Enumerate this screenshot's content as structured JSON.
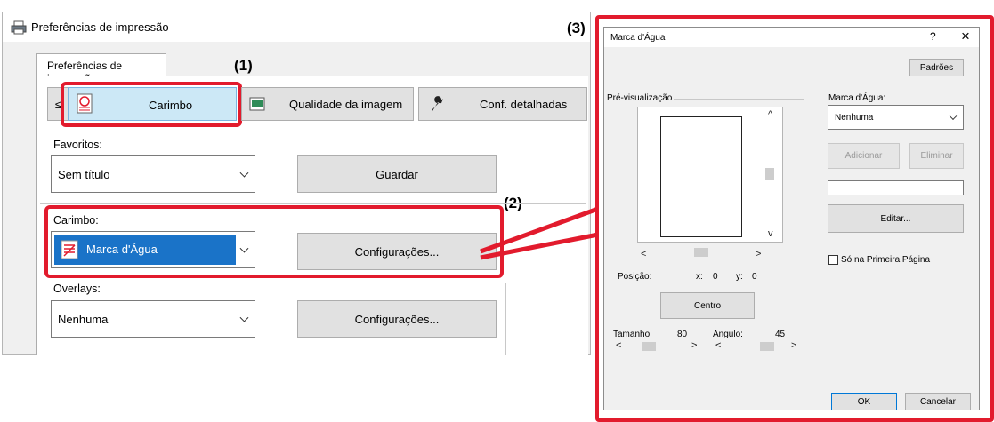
{
  "left_window": {
    "title": "Preferências de impressão",
    "tab": "Preferências de impressão",
    "nav_back": "≤",
    "tabs": [
      {
        "label": "Carimbo"
      },
      {
        "label": "Qualidade da imagem"
      },
      {
        "label": "Conf. detalhadas"
      }
    ],
    "favoritos": {
      "label": "Favoritos:",
      "value": "Sem título",
      "save": "Guardar"
    },
    "carimbo": {
      "label": "Carimbo:",
      "value": "Marca d'Água",
      "settings": "Configurações..."
    },
    "overlays": {
      "label": "Overlays:",
      "value": "Nenhuma",
      "settings": "Configurações..."
    }
  },
  "callouts": {
    "c1": "(1)",
    "c2": "(2)",
    "c3": "(3)"
  },
  "watermark_dialog": {
    "title": "Marca d'Água",
    "help": "?",
    "close": "×",
    "defaults": "Padrões",
    "preview_label": "Pré-visualização",
    "position_label": "Posição:",
    "x_label": "x:",
    "x_value": "0",
    "y_label": "y:",
    "y_value": "0",
    "center": "Centro",
    "size_label": "Tamanho:",
    "size_value": "80",
    "angle_label": "Angulo:",
    "angle_value": "45",
    "watermark_label": "Marca d'Água:",
    "watermark_value": "Nenhuma",
    "add": "Adicionar",
    "delete": "Eliminar",
    "text_value": "",
    "edit": "Editar...",
    "first_page_only": "Só na Primeira Página",
    "ok": "OK",
    "cancel": "Cancelar"
  },
  "colors": {
    "highlight_red": "#e21b2d",
    "selection_blue": "#1a73c8",
    "tab_selected": "#cce8f6"
  }
}
